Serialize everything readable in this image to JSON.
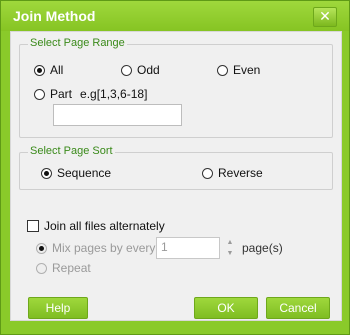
{
  "window": {
    "title": "Join Method",
    "close_glyph": "✕"
  },
  "page_range": {
    "title": "Select Page Range",
    "options": {
      "all": "All",
      "odd": "Odd",
      "even": "Even",
      "part": "Part"
    },
    "selected": "all",
    "part_hint": "e.g[1,3,6-18]",
    "part_value": ""
  },
  "page_sort": {
    "title": "Select Page Sort",
    "options": {
      "sequence": "Sequence",
      "reverse": "Reverse"
    },
    "selected": "sequence"
  },
  "alternate": {
    "label": "Join all files alternately",
    "checked": false,
    "mix_label": "Mix pages by every",
    "mix_value": "1",
    "unit": "page(s)",
    "repeat_label": "Repeat"
  },
  "buttons": {
    "help": "Help",
    "ok": "OK",
    "cancel": "Cancel"
  },
  "colors": {
    "accent": "#8aca2a",
    "group_title": "#3a8a1a"
  }
}
